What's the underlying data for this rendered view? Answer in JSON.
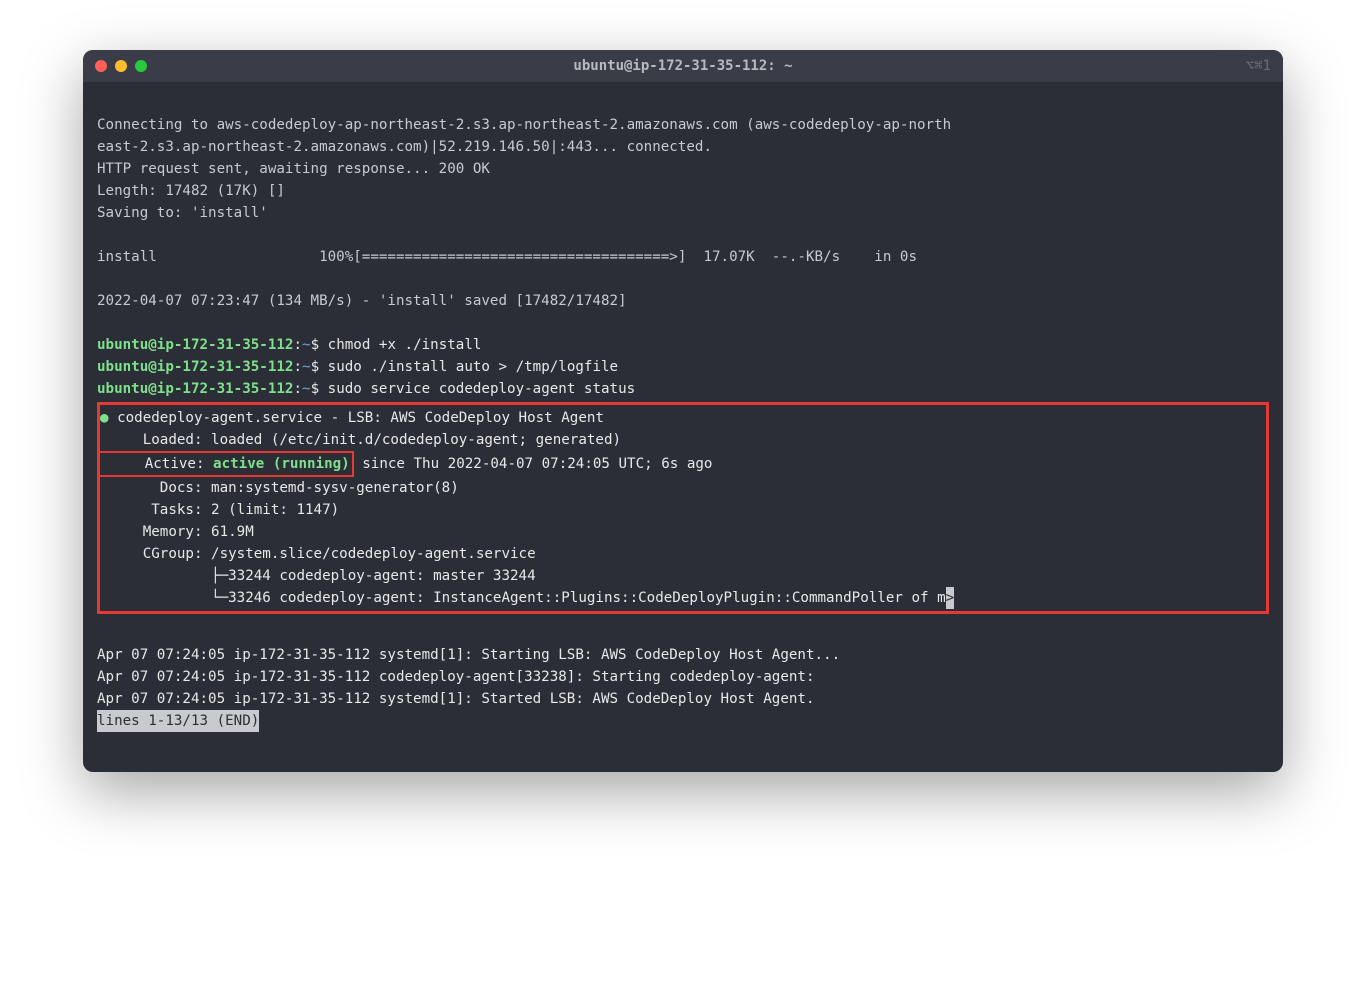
{
  "window": {
    "title": "ubuntu@ip-172-31-35-112: ~",
    "shortcut": "⌥⌘1"
  },
  "lines": {
    "l1": "Connecting to aws-codedeploy-ap-northeast-2.s3.ap-northeast-2.amazonaws.com (aws-codedeploy-ap-north",
    "l2": "east-2.s3.ap-northeast-2.amazonaws.com)|52.219.146.50|:443... connected.",
    "l3": "HTTP request sent, awaiting response... 200 OK",
    "l4": "Length: 17482 (17K) []",
    "l5": "Saving to: 'install'",
    "l6": "",
    "l7": "install                   100%[====================================>]  17.07K  --.-KB/s    in 0s",
    "l8": "",
    "l9": "2022-04-07 07:23:47 (134 MB/s) - 'install' saved [17482/17482]",
    "l10": ""
  },
  "prompts": {
    "host": "ubuntu@ip-172-31-35-112",
    "sep": ":",
    "path": "~",
    "dollar": "$",
    "cmd1": " chmod +x ./install",
    "cmd2": " sudo ./install auto > /tmp/logfile",
    "cmd3": " sudo service codedeploy-agent status"
  },
  "status": {
    "dot": "●",
    "header": " codedeploy-agent.service - LSB: AWS CodeDeploy Host Agent",
    "loaded": "     Loaded: loaded (/etc/init.d/codedeploy-agent; generated)",
    "active_label": "     Active: ",
    "active_value": "active (running)",
    "active_rest": " since Thu 2022-04-07 07:24:05 UTC; 6s ago",
    "docs": "       Docs: man:systemd-sysv-generator(8)",
    "tasks": "      Tasks: 2 (limit: 1147)",
    "memory": "     Memory: 61.9M",
    "cgroup": "     CGroup: /system.slice/codedeploy-agent.service",
    "proc1": "             ├─33244 codedeploy-agent: master 33244",
    "proc2_pre": "             └─33246 codedeploy-agent: InstanceAgent::Plugins::CodeDeployPlugin::CommandPoller of m",
    "proc2_end": ">"
  },
  "logs": {
    "log1": "Apr 07 07:24:05 ip-172-31-35-112 systemd[1]: Starting LSB: AWS CodeDeploy Host Agent...",
    "log2": "Apr 07 07:24:05 ip-172-31-35-112 codedeploy-agent[33238]: Starting codedeploy-agent:",
    "log3": "Apr 07 07:24:05 ip-172-31-35-112 systemd[1]: Started LSB: AWS CodeDeploy Host Agent."
  },
  "pager": "lines 1-13/13 (END)"
}
